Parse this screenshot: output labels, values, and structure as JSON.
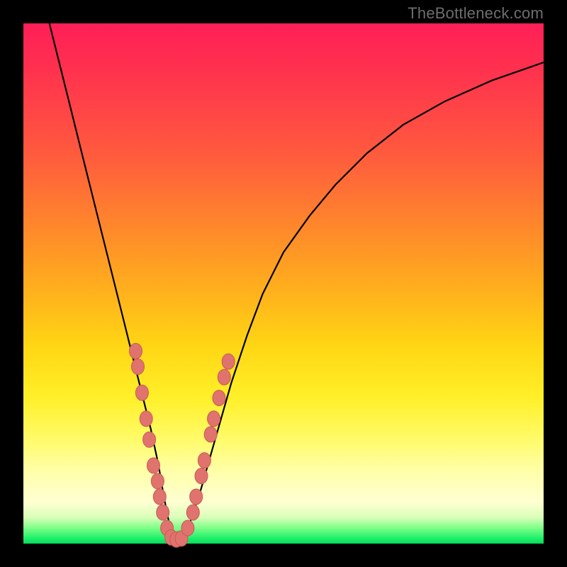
{
  "watermark": "TheBottleneck.com",
  "colors": {
    "frame": "#000000",
    "line": "#000000",
    "marker_fill": "#e0736e",
    "marker_stroke": "#c95a55"
  },
  "chart_data": {
    "type": "line",
    "title": "",
    "xlabel": "",
    "ylabel": "",
    "xlim": [
      0,
      100
    ],
    "ylim": [
      0,
      100
    ],
    "series": [
      {
        "name": "bottleneck-curve",
        "x": [
          5,
          7,
          9,
          11,
          13,
          15,
          17,
          19,
          21,
          23,
          24.5,
          26,
          27,
          28,
          28.7,
          29.5,
          30.5,
          32,
          34,
          36,
          38,
          40,
          43,
          46,
          50,
          55,
          60,
          66,
          73,
          81,
          90,
          100
        ],
        "y": [
          100,
          92,
          84,
          76,
          68,
          60,
          52,
          44,
          36,
          28,
          22,
          15,
          9,
          4,
          1.2,
          0.8,
          1.2,
          4,
          10,
          17,
          24,
          31,
          40,
          48,
          56,
          63,
          69,
          75,
          80.5,
          85,
          89,
          92.5
        ]
      }
    ],
    "markers": {
      "name": "highlighted-points",
      "points": [
        {
          "x": 21.6,
          "y": 37
        },
        {
          "x": 22.0,
          "y": 34
        },
        {
          "x": 22.8,
          "y": 29
        },
        {
          "x": 23.6,
          "y": 24
        },
        {
          "x": 24.2,
          "y": 20
        },
        {
          "x": 25.0,
          "y": 15
        },
        {
          "x": 25.8,
          "y": 12
        },
        {
          "x": 26.2,
          "y": 9
        },
        {
          "x": 26.8,
          "y": 6
        },
        {
          "x": 27.6,
          "y": 3
        },
        {
          "x": 28.4,
          "y": 1.2
        },
        {
          "x": 29.4,
          "y": 0.8
        },
        {
          "x": 30.4,
          "y": 1.0
        },
        {
          "x": 31.6,
          "y": 3
        },
        {
          "x": 32.6,
          "y": 6
        },
        {
          "x": 33.2,
          "y": 9
        },
        {
          "x": 34.2,
          "y": 13
        },
        {
          "x": 34.8,
          "y": 16
        },
        {
          "x": 36.0,
          "y": 21
        },
        {
          "x": 36.6,
          "y": 24
        },
        {
          "x": 37.6,
          "y": 28
        },
        {
          "x": 38.6,
          "y": 32
        },
        {
          "x": 39.4,
          "y": 35
        }
      ]
    }
  }
}
